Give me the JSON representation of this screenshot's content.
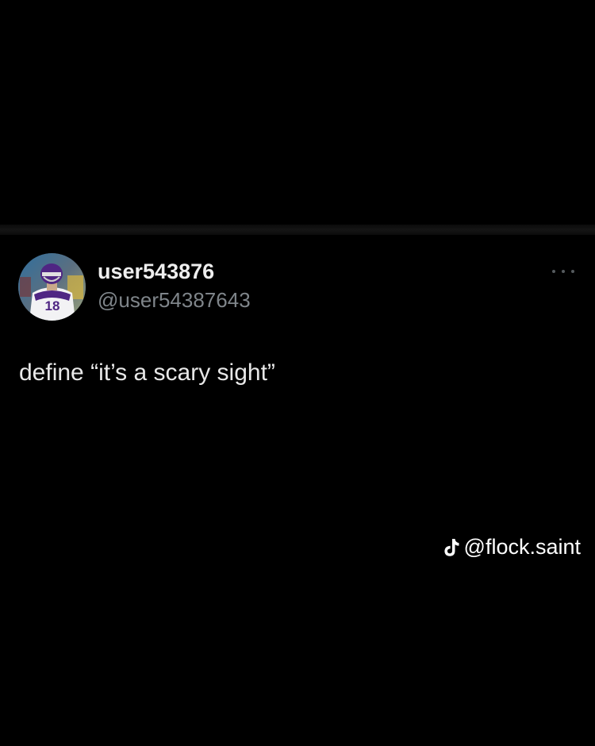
{
  "tweet": {
    "display_name": "user543876",
    "handle": "@user54387643",
    "text": "define “it’s a scary sight”",
    "avatar_jersey_number": "18"
  },
  "watermark": {
    "icon": "tiktok-icon",
    "text": "@flock.saint"
  },
  "colors": {
    "background": "#000000",
    "name": "#eeeeee",
    "handle": "#7f858a",
    "body_text": "#e8e8e8"
  }
}
